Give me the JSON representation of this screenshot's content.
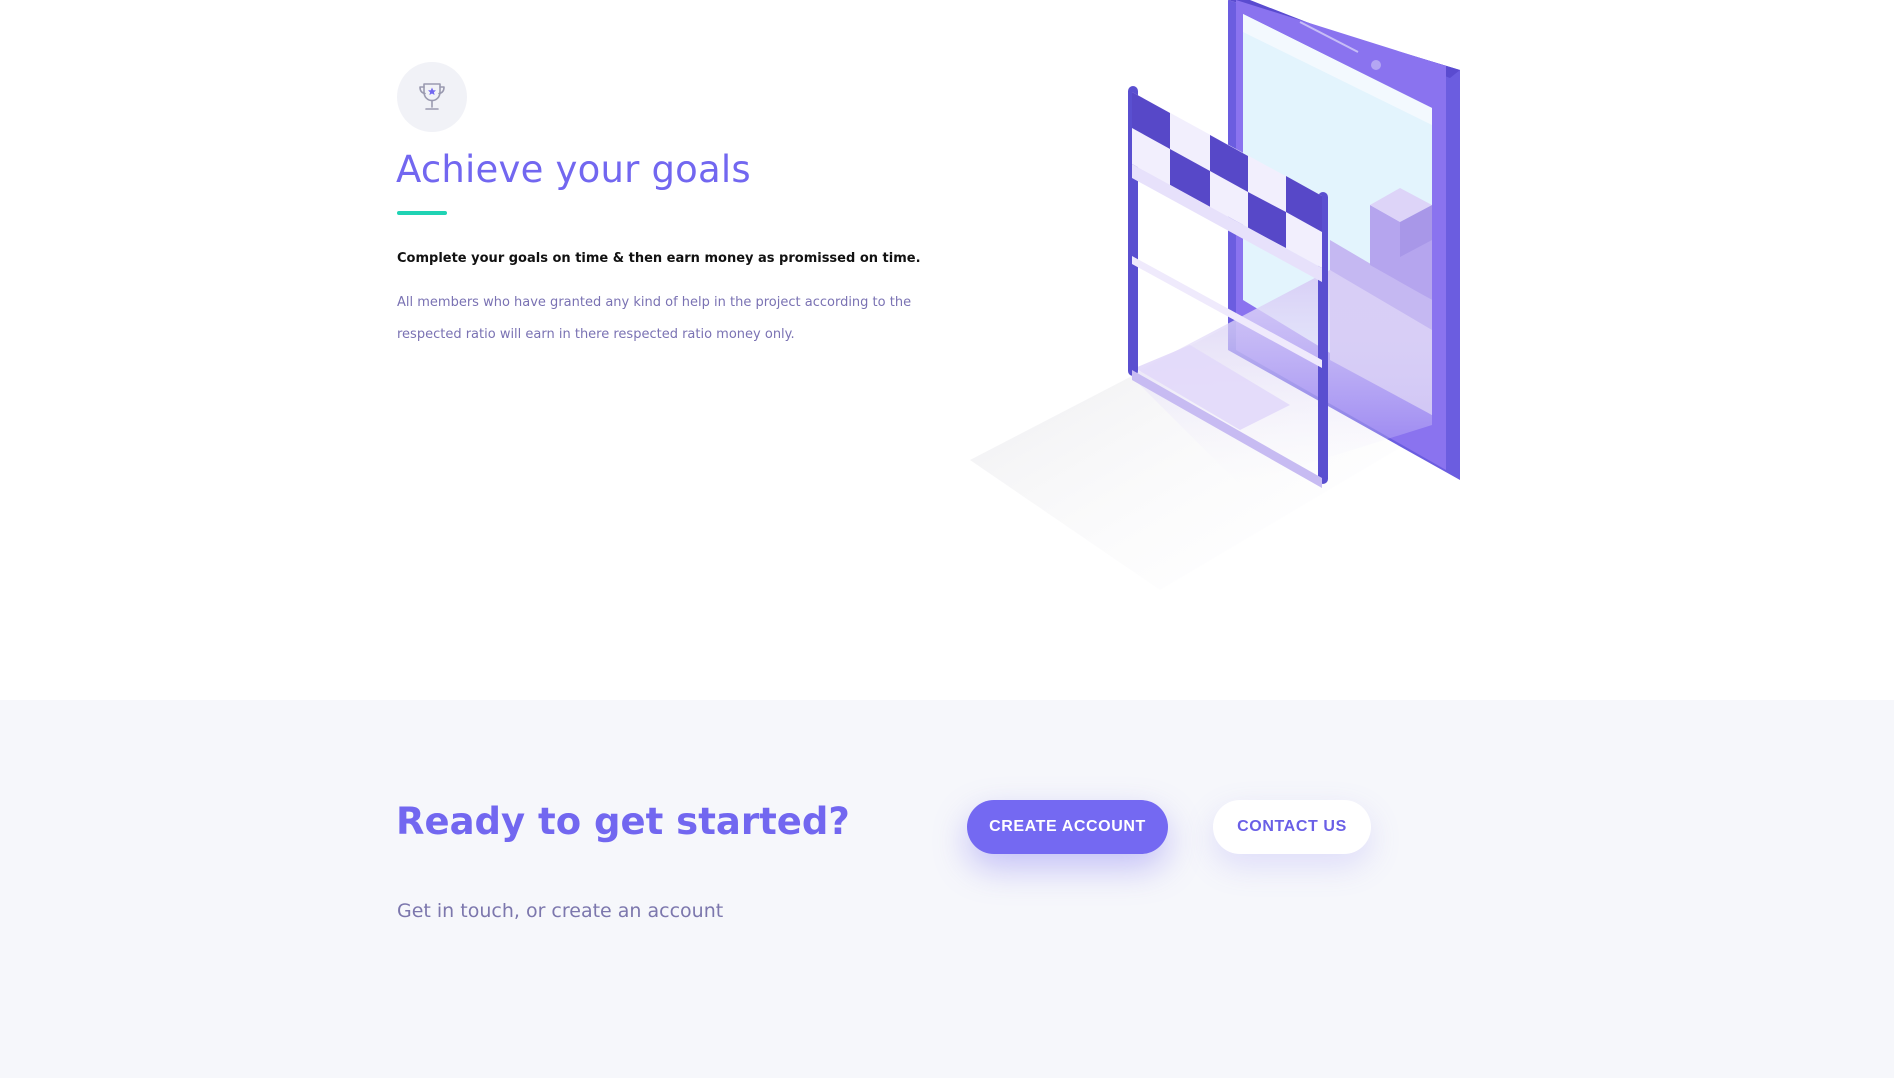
{
  "feature": {
    "icon": "trophy-icon",
    "title": "Achieve your goals",
    "lead": "Complete your goals on time & then earn money as promissed on time.",
    "description": "All members who have granted any kind of help in the project according to the respected ratio will earn in there respected ratio money only.",
    "illustration": "finish-line-phone-illustration"
  },
  "cta": {
    "title": "Ready to get started?",
    "subtitle": "Get in touch, or create an account",
    "primary_button": "CREATE ACCOUNT",
    "secondary_button": "CONTACT US"
  },
  "colors": {
    "accent": "#7267f0",
    "underline": "#1fd3b4",
    "cta_background": "#f6f7fb",
    "muted_text": "#7a72b3"
  }
}
